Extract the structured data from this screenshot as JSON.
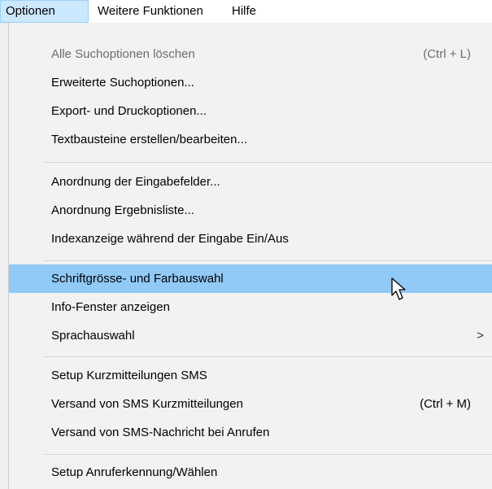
{
  "menubar": {
    "items": [
      {
        "label": "Optionen"
      },
      {
        "label": "Weitere Funktionen"
      },
      {
        "label": "Hilfe"
      }
    ]
  },
  "menu": {
    "items": [
      {
        "label": "Alle Suchoptionen löschen",
        "shortcut": "(Ctrl + L)",
        "disabled": true
      },
      {
        "label": "Erweiterte Suchoptionen...",
        "shortcut": ""
      },
      {
        "label": "Export- und Druckoptionen...",
        "shortcut": ""
      },
      {
        "label": "Textbausteine erstellen/bearbeiten...",
        "shortcut": ""
      },
      {
        "label": "Anordnung der Eingabefelder...",
        "shortcut": ""
      },
      {
        "label": "Anordnung Ergebnisliste...",
        "shortcut": ""
      },
      {
        "label": "Indexanzeige während der Eingabe Ein/Aus",
        "shortcut": ""
      },
      {
        "label": "Schriftgrösse- und Farbauswahl",
        "shortcut": "",
        "highlighted": true
      },
      {
        "label": "Info-Fenster anzeigen",
        "shortcut": ""
      },
      {
        "label": "Sprachauswahl",
        "shortcut": "",
        "submenu_arrow": ">"
      },
      {
        "label": "Setup Kurzmitteilungen SMS",
        "shortcut": ""
      },
      {
        "label": "Versand von SMS Kurzmitteilungen",
        "shortcut": "(Ctrl + M)"
      },
      {
        "label": "Versand von SMS-Nachricht bei Anrufen",
        "shortcut": ""
      },
      {
        "label": "Setup Anruferkennung/Wählen",
        "shortcut": ""
      }
    ]
  },
  "colors": {
    "menubar_active_bg": "#cce8ff",
    "menu_bg": "#f2f2f2",
    "hover_bg": "#91c9f7",
    "disabled_text": "#6d6d6d"
  }
}
